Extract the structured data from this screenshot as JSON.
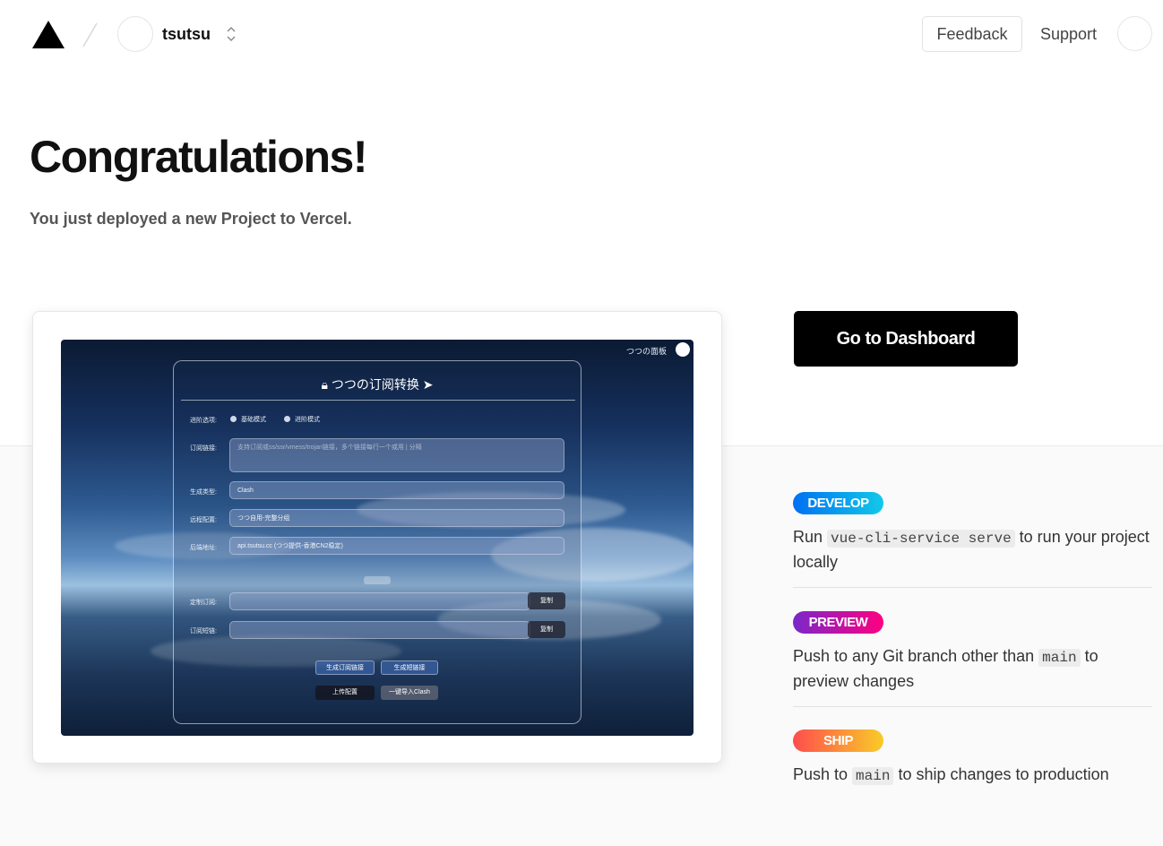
{
  "header": {
    "team_name": "tsutsu",
    "feedback_label": "Feedback",
    "support_label": "Support"
  },
  "hero": {
    "title": "Congratulations!",
    "subtitle": "You just deployed a new Project to Vercel."
  },
  "preview": {
    "top_label": "つつの面板",
    "panel_title": "つつの订阅转换",
    "rows": {
      "mode_label": "进阶选项:",
      "mode_basic": "基础模式",
      "mode_advanced": "进阶模式",
      "sub_label": "订阅链接:",
      "sub_placeholder": "支持订阅或ss/ssr/vmess/trojan链接，多个链接每行一个或用 | 分隔",
      "type_label": "生成类型:",
      "type_value": "Clash",
      "remote_label": "远程配置:",
      "remote_value": "つつ自用-完整分组",
      "backend_label": "后端地址:",
      "backend_value": "api.tsutsu.cc (つつ提供-香港CN2稳定)",
      "custom_sub_label": "定制订阅:",
      "short_label": "订阅短链:",
      "copy_label": "复制",
      "gen_sub_btn": "生成订阅链接",
      "gen_short_btn": "生成短链接",
      "upload_btn": "上传配置",
      "import_btn": "一键导入Clash"
    }
  },
  "dashboard_button": "Go to Dashboard",
  "steps": [
    {
      "badge": "DEVELOP",
      "pre": "Run ",
      "code": "vue-cli-service serve",
      "post": " to run your project locally"
    },
    {
      "badge": "PREVIEW",
      "pre": "Push to any Git branch other than ",
      "code": "main",
      "post": " to preview changes"
    },
    {
      "badge": "SHIP",
      "pre": "Push to ",
      "code": "main",
      "post": " to ship changes to production"
    }
  ],
  "colors": {
    "develop": "#0a8bf0",
    "preview": "#9c27c8",
    "ship": "#ff5a4f"
  }
}
